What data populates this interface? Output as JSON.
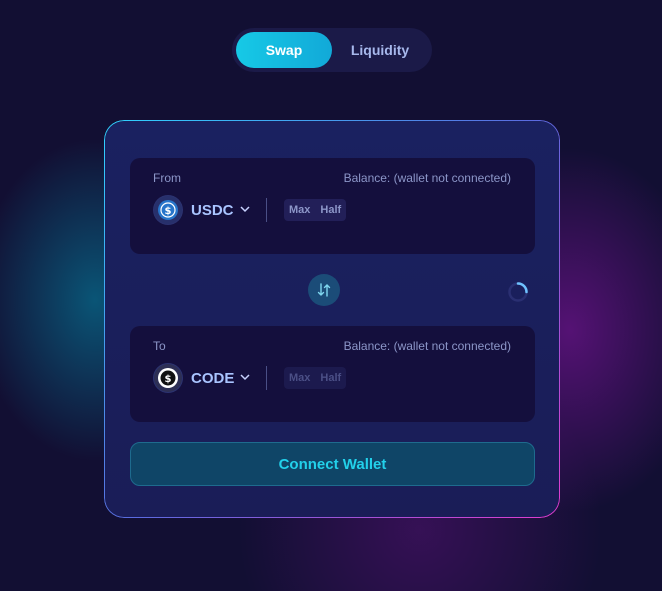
{
  "tabs": [
    {
      "label": "Swap",
      "active": true
    },
    {
      "label": "Liquidity",
      "active": false
    }
  ],
  "from": {
    "label": "From",
    "balance": "Balance: (wallet not connected)",
    "token": {
      "symbol": "USDC",
      "icon": "usdc-icon"
    },
    "max_label": "Max",
    "half_label": "Half"
  },
  "to": {
    "label": "To",
    "balance": "Balance: (wallet not connected)",
    "token": {
      "symbol": "CODE",
      "icon": "code-icon"
    },
    "max_label": "Max",
    "half_label": "Half"
  },
  "connect_label": "Connect Wallet",
  "colors": {
    "accent": "#16c9e6",
    "background": "#120f33",
    "card": "#1a2160",
    "panel": "#140f3d"
  }
}
